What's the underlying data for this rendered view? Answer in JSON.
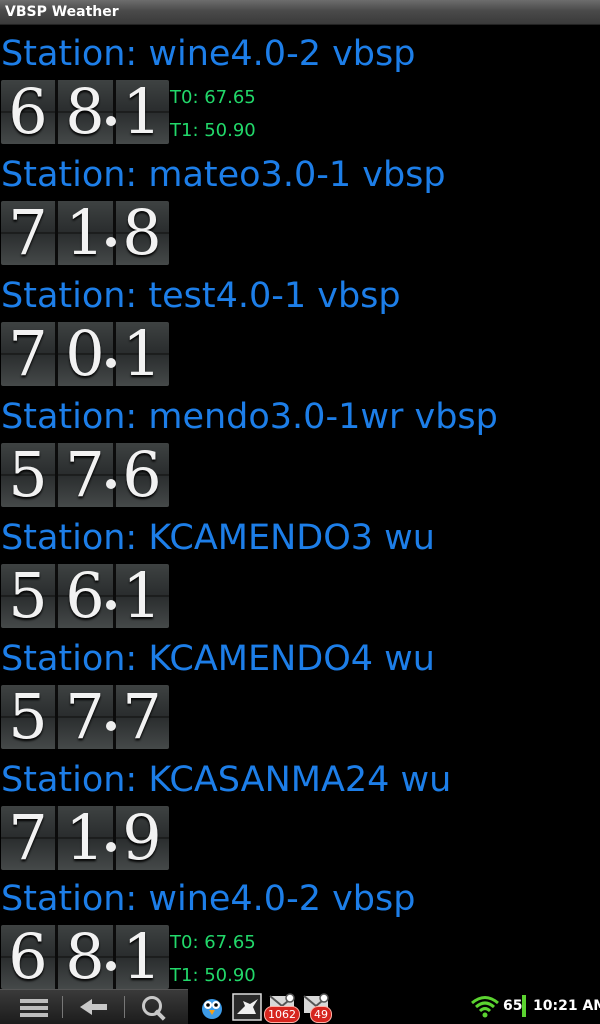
{
  "app": {
    "title": "VBSP Weather"
  },
  "stations": [
    {
      "name": "Station: wine4.0-2 vbsp",
      "digits": [
        "6",
        "8",
        "1"
      ],
      "t0": "T0: 67.65",
      "t1": "T1: 50.90"
    },
    {
      "name": "Station: mateo3.0-1 vbsp",
      "digits": [
        "7",
        "1",
        "8"
      ]
    },
    {
      "name": "Station: test4.0-1 vbsp",
      "digits": [
        "7",
        "0",
        "1"
      ]
    },
    {
      "name": "Station: mendo3.0-1wr vbsp",
      "digits": [
        "5",
        "7",
        "6"
      ]
    },
    {
      "name": "Station: KCAMENDO3 wu",
      "digits": [
        "5",
        "6",
        "1"
      ]
    },
    {
      "name": "Station: KCAMENDO4 wu",
      "digits": [
        "5",
        "7",
        "7"
      ]
    },
    {
      "name": "Station: KCASANMA24 wu",
      "digits": [
        "7",
        "1",
        "9"
      ]
    },
    {
      "name": "Station: wine4.0-2 vbsp",
      "digits": [
        "6",
        "8",
        "1"
      ],
      "t0": "T0: 67.65",
      "t1": "T1: 50.90"
    }
  ],
  "status_bar": {
    "nav_icons": [
      "menu-icon",
      "back-icon",
      "search-icon"
    ],
    "notifications": [
      {
        "icon": "bird-app-icon"
      },
      {
        "icon": "crow-app-icon"
      },
      {
        "icon": "email-icon",
        "badge": "1062"
      },
      {
        "icon": "email-icon",
        "badge": "49"
      }
    ],
    "wifi_icon": "wifi-icon",
    "battery": "65",
    "battery_color": "#5bd330",
    "time": "10:21 AM"
  },
  "colors": {
    "station_name": "#1d7ee8",
    "reading": "#22d86a",
    "background": "#000000"
  }
}
